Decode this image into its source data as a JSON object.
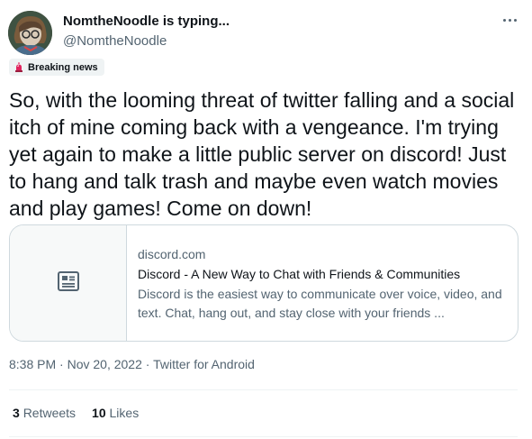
{
  "author": {
    "display_name": "NomtheNoodle is typing...",
    "handle": "@NomtheNoodle"
  },
  "badge": {
    "icon": "siren-icon",
    "label": "Breaking news"
  },
  "tweet": {
    "text": "So, with the looming threat of twitter falling and a social itch of mine coming back with a vengeance. I'm trying yet again to make a little public server on discord! Just to hang and talk trash and maybe even watch movies and play games! Come on down!"
  },
  "link_card": {
    "icon": "article-icon",
    "domain": "discord.com",
    "title": "Discord - A New Way to Chat with Friends & Communities",
    "description": "Discord is the easiest way to communicate over voice, video, and text. Chat, hang out, and stay close with your friends ..."
  },
  "meta": {
    "time": "8:38 PM",
    "separator1": " · ",
    "date": "Nov 20, 2022",
    "separator2": " · ",
    "source": "Twitter for Android"
  },
  "stats": {
    "retweets_count": "3",
    "retweets_label": "Retweets",
    "likes_count": "10",
    "likes_label": "Likes"
  },
  "colors": {
    "text_primary": "#0f1419",
    "text_secondary": "#536471",
    "border": "#cfd9de",
    "badge_bg": "#eff3f4"
  }
}
